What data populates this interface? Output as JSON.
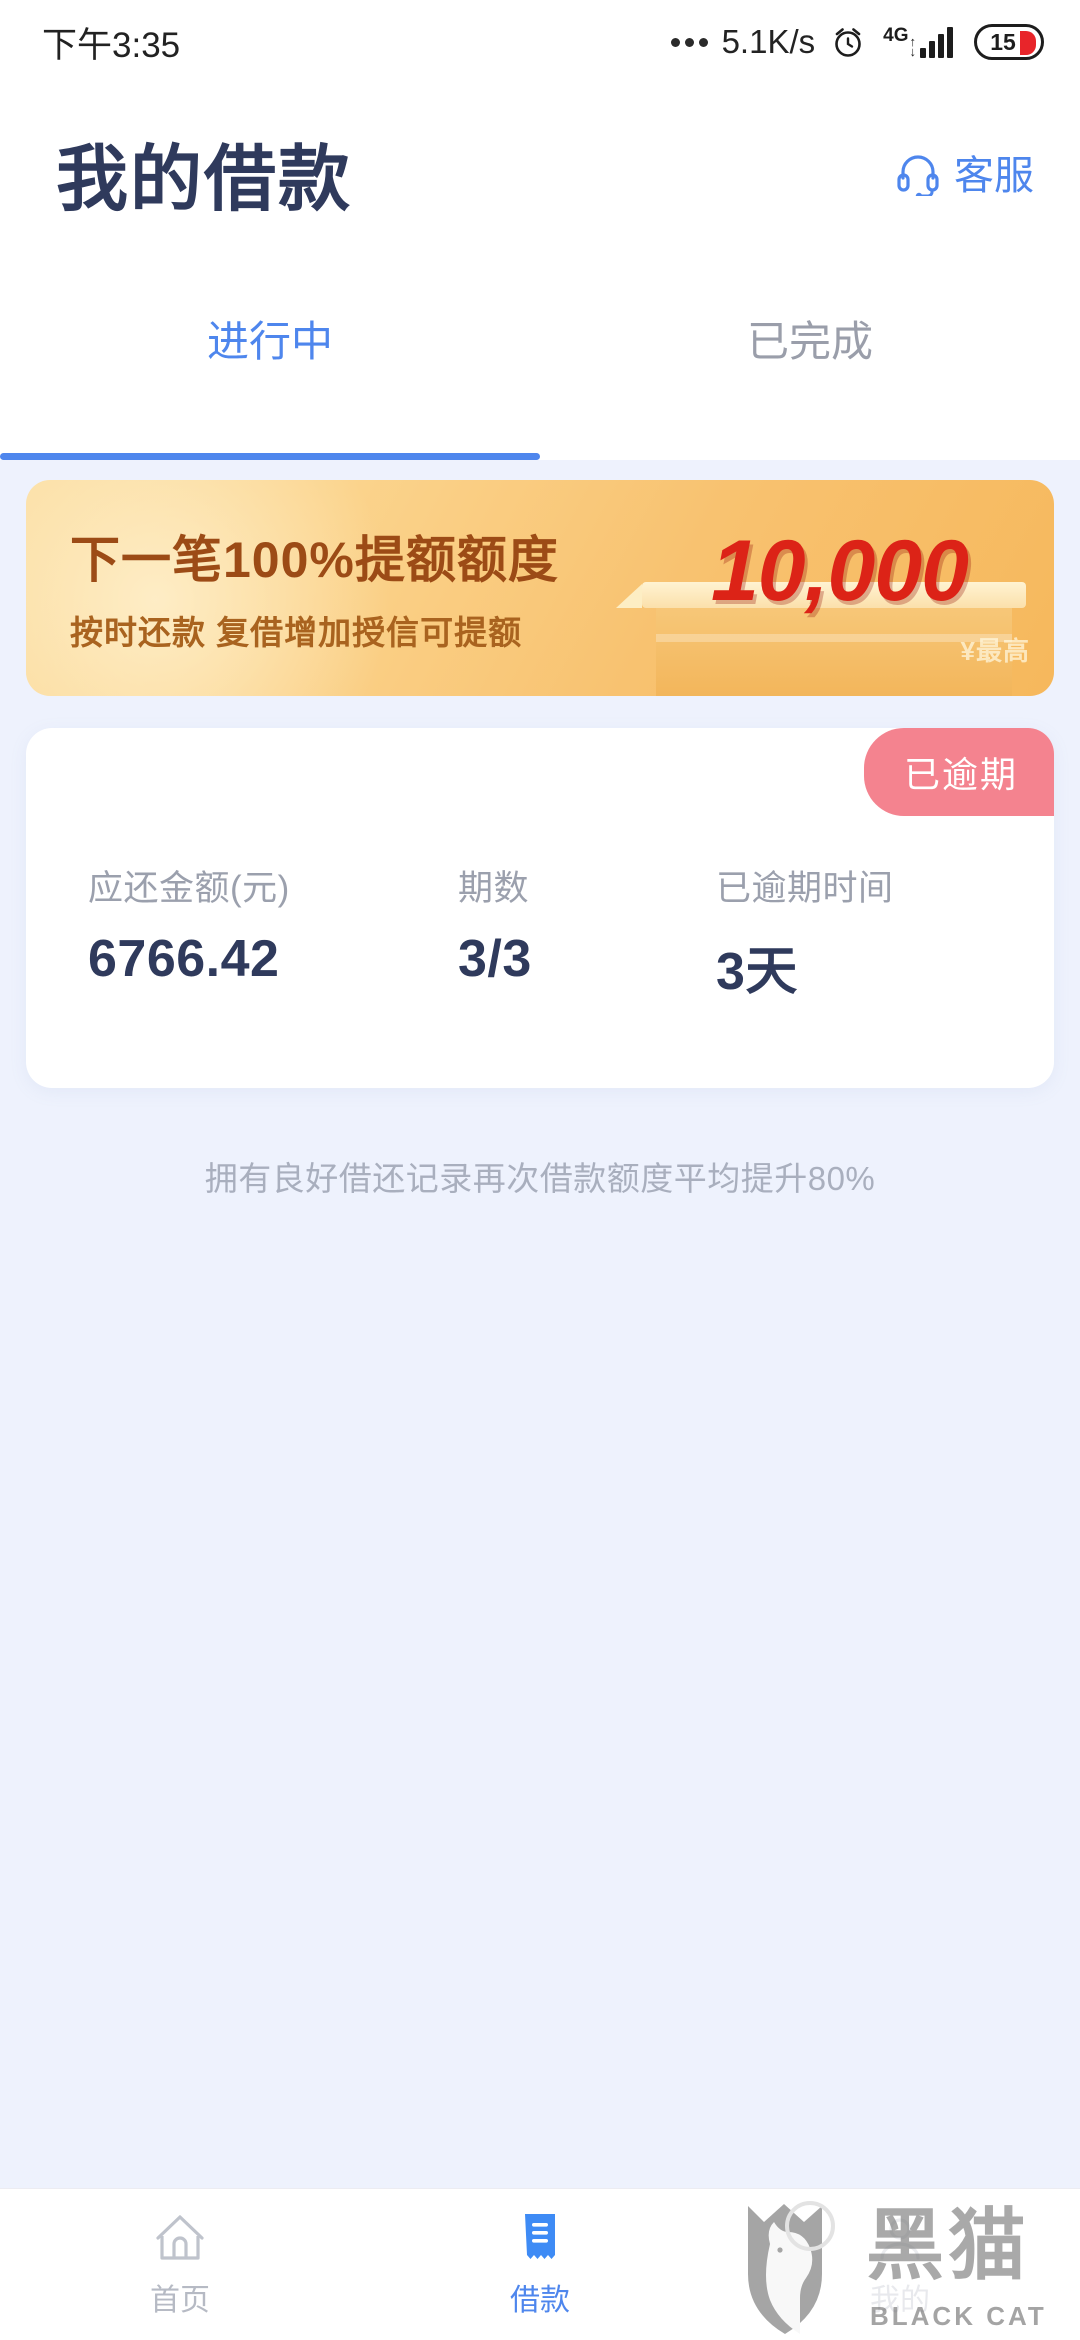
{
  "statusbar": {
    "time": "下午3:35",
    "dots_icon": "more-dots-icon",
    "network_speed": "5.1K/s",
    "alarm_icon": "alarm-clock-icon",
    "network_type": "4G",
    "signal_icon": "signal-bars-icon",
    "battery_level": "15"
  },
  "header": {
    "title": "我的借款",
    "support_icon": "headset-icon",
    "support_label": "客服"
  },
  "tabs": [
    {
      "label": "进行中",
      "active": true
    },
    {
      "label": "已完成",
      "active": false
    }
  ],
  "banner": {
    "title": "下一笔100%提额额度",
    "subtitle": "按时还款  复借增加授信可提额",
    "amount": "10,000",
    "max_label": "¥最高",
    "bg_start_color": "#fbdda0",
    "bg_end_color": "#f6b85c",
    "title_color": "#9c4b16",
    "amount_color": "#dc2317"
  },
  "loan_card": {
    "status_badge": "已逾期",
    "status_badge_color": "#f4838f",
    "stats": [
      {
        "label": "应还金额(元)",
        "value": "6766.42"
      },
      {
        "label": "期数",
        "value": "3/3"
      },
      {
        "label": "已逾期时间",
        "value": "3天"
      }
    ]
  },
  "tip_note": "拥有良好借还记录再次借款额度平均提升80%",
  "bottom_nav": [
    {
      "label": "首页",
      "icon": "home-icon",
      "active": false
    },
    {
      "label": "借款",
      "icon": "receipt-icon",
      "active": true
    },
    {
      "label": "我的",
      "icon": "person-icon",
      "active": false
    }
  ],
  "watermark": {
    "cn_text": "黑猫",
    "en_text": "BLACK CAT",
    "icon": "black-cat-shield-logo"
  },
  "colors": {
    "page_background": "#eef2fd",
    "accent_blue": "#4e86ed",
    "text_dark_navy": "#2f3a5c",
    "text_muted": "#9ba0ad"
  }
}
